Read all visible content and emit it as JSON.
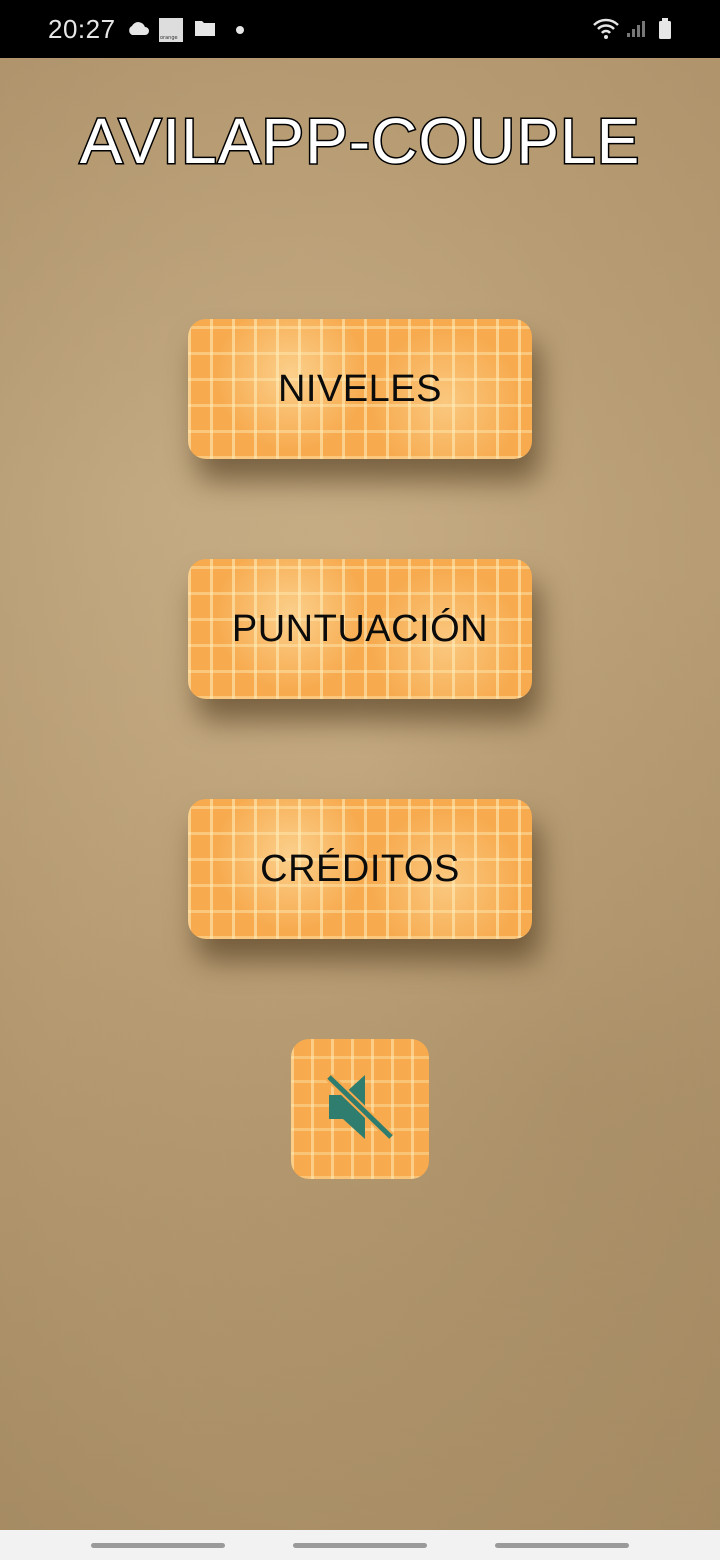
{
  "status_bar": {
    "time": "20:27",
    "carrier_badge": "orange",
    "icons": [
      "cloud-icon",
      "orange-badge-icon",
      "folder-icon",
      "notification-dot-icon",
      "wifi-icon",
      "signal-icon",
      "battery-icon"
    ]
  },
  "app": {
    "title": "AVILAPP-COUPLE"
  },
  "menu": {
    "buttons": [
      {
        "label": "NIVELES"
      },
      {
        "label": "PUNTUACIÓN"
      },
      {
        "label": "CRÉDITOS"
      }
    ],
    "sound_toggle": {
      "icon": "volume-muted-icon",
      "state": "muted"
    }
  },
  "colors": {
    "button_fill": "#f7aa4e",
    "button_text": "#0b0b0b",
    "icon_teal": "#2e7d6e",
    "background_parchment": "#c3a77d"
  },
  "nav_bar": {
    "items": [
      "recent-apps",
      "home",
      "back"
    ]
  }
}
